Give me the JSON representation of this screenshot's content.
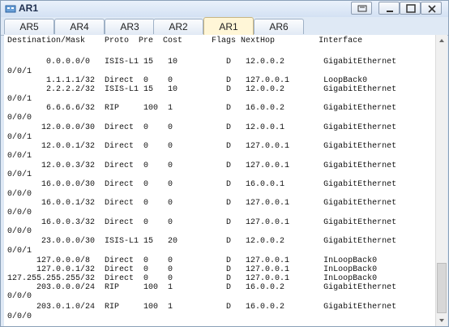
{
  "window": {
    "title": "AR1"
  },
  "tabs": [
    {
      "label": "AR5"
    },
    {
      "label": "AR4"
    },
    {
      "label": "AR3"
    },
    {
      "label": "AR2"
    },
    {
      "label": "AR1",
      "active": true
    },
    {
      "label": "AR6"
    }
  ],
  "console": {
    "lines": [
      "Destination/Mask    Proto  Pre  Cost      Flags NextHop         Interface",
      "",
      "        0.0.0.0/0   ISIS-L1 15   10          D   12.0.0.2        GigabitEthernet",
      "0/0/1",
      "        1.1.1.1/32  Direct  0    0           D   127.0.0.1       LoopBack0",
      "        2.2.2.2/32  ISIS-L1 15   10          D   12.0.0.2        GigabitEthernet",
      "0/0/1",
      "        6.6.6.6/32  RIP     100  1           D   16.0.0.2        GigabitEthernet",
      "0/0/0",
      "       12.0.0.0/30  Direct  0    0           D   12.0.0.1        GigabitEthernet",
      "0/0/1",
      "       12.0.0.1/32  Direct  0    0           D   127.0.0.1       GigabitEthernet",
      "0/0/1",
      "       12.0.0.3/32  Direct  0    0           D   127.0.0.1       GigabitEthernet",
      "0/0/1",
      "       16.0.0.0/30  Direct  0    0           D   16.0.0.1        GigabitEthernet",
      "0/0/0",
      "       16.0.0.1/32  Direct  0    0           D   127.0.0.1       GigabitEthernet",
      "0/0/0",
      "       16.0.0.3/32  Direct  0    0           D   127.0.0.1       GigabitEthernet",
      "0/0/0",
      "       23.0.0.0/30  ISIS-L1 15   20          D   12.0.0.2        GigabitEthernet",
      "0/0/1",
      "      127.0.0.0/8   Direct  0    0           D   127.0.0.1       InLoopBack0",
      "      127.0.0.1/32  Direct  0    0           D   127.0.0.1       InLoopBack0",
      "127.255.255.255/32  Direct  0    0           D   127.0.0.1       InLoopBack0",
      "      203.0.0.0/24  RIP     100  1           D   16.0.0.2        GigabitEthernet",
      "0/0/0",
      "      203.0.1.0/24  RIP     100  1           D   16.0.0.2        GigabitEthernet",
      "0/0/0"
    ]
  }
}
